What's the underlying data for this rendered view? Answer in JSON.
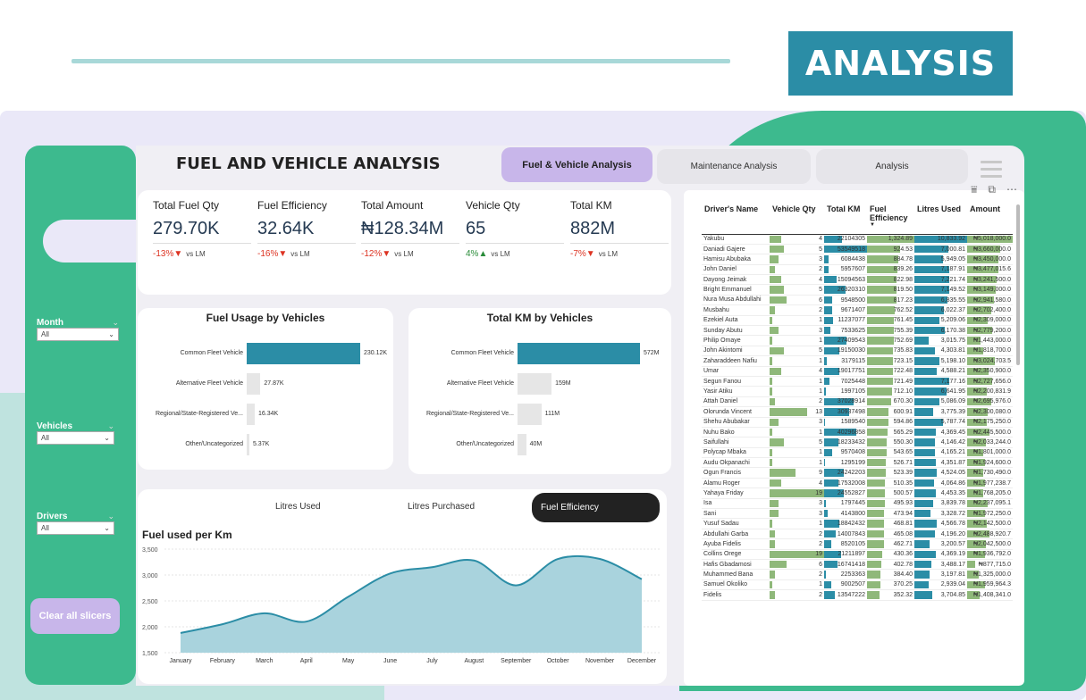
{
  "header": {
    "badge": "ANALYSIS"
  },
  "dashboard": {
    "title": "FUEL AND VEHICLE ANALYSIS",
    "tabs": [
      {
        "label": "Fuel & Vehicle Analysis",
        "active": true
      },
      {
        "label": "Maintenance Analysis",
        "active": false
      },
      {
        "label": "Analysis",
        "active": false
      }
    ]
  },
  "sidebar": {
    "slicers": [
      {
        "label": "Month",
        "value": "All"
      },
      {
        "label": "Vehicles",
        "value": "All"
      },
      {
        "label": "Drivers",
        "value": "All"
      }
    ],
    "clear_button": "Clear all slicers"
  },
  "kpis": [
    {
      "label": "Total Fuel Qty",
      "value": "279.70K",
      "change": "-13%",
      "direction": "down",
      "vs": "vs LM"
    },
    {
      "label": "Fuel Efficiency",
      "value": "32.64K",
      "change": "-16%",
      "direction": "down",
      "vs": "vs LM"
    },
    {
      "label": "Total Amount",
      "value": "₦128.34M",
      "change": "-12%",
      "direction": "down",
      "vs": "vs LM"
    },
    {
      "label": "Vehicle Qty",
      "value": "65",
      "change": "4%",
      "direction": "up",
      "vs": "vs LM"
    },
    {
      "label": "Total KM",
      "value": "882M",
      "change": "-7%",
      "direction": "down",
      "vs": "vs LM"
    }
  ],
  "chart_data": [
    {
      "type": "bar",
      "title": "Fuel Usage by Vehicles",
      "orientation": "horizontal",
      "categories": [
        "Common Fleet Vehicle",
        "Alternative Fleet Vehicle",
        "Regional/State-Registered Ve...",
        "Other/Uncategorized"
      ],
      "values": [
        230120,
        27870,
        16340,
        5370
      ],
      "value_labels": [
        "230.12K",
        "27.87K",
        "16.34K",
        "5.37K"
      ],
      "colors": [
        "#2b8da6",
        "#e6e6e6",
        "#e6e6e6",
        "#e6e6e6"
      ]
    },
    {
      "type": "bar",
      "title": "Total KM by Vehicles",
      "orientation": "horizontal",
      "categories": [
        "Common Fleet Vehicle",
        "Alternative Fleet Vehicle",
        "Regional/State-Registered Ve...",
        "Other/Uncategorized"
      ],
      "values": [
        572,
        159,
        111,
        40
      ],
      "value_labels": [
        "572M",
        "159M",
        "111M",
        "40M"
      ],
      "colors": [
        "#2b8da6",
        "#e6e6e6",
        "#e6e6e6",
        "#e6e6e6"
      ]
    },
    {
      "type": "area",
      "title": "Fuel used per Km",
      "categories": [
        "January",
        "February",
        "March",
        "April",
        "May",
        "June",
        "July",
        "August",
        "September",
        "October",
        "November",
        "December"
      ],
      "values": [
        1880,
        2050,
        2260,
        2100,
        2580,
        3030,
        3150,
        3280,
        2800,
        3310,
        3310,
        2920
      ],
      "ylim": [
        1500,
        3500
      ],
      "yticks": [
        "3,500",
        "3,000",
        "2,500",
        "2,000",
        "1,500"
      ],
      "ytick_values": [
        3500,
        3000,
        2500,
        2000,
        1500
      ],
      "colors": {
        "fill": "#a9d3dd",
        "line": "#2b8da6"
      }
    }
  ],
  "line_segments": [
    "Litres Used",
    "Litres Purchased",
    "Fuel Efficiency"
  ],
  "table": {
    "columns": [
      "Driver's Name",
      "Vehicle Qty",
      "Total KM",
      "Fuel Efficiency",
      "Litres Used",
      "Amount"
    ],
    "rows": [
      [
        "Yakubu",
        "4",
        "22104305",
        "1,324.89",
        "10,833.92",
        "₦5,018,000.0"
      ],
      [
        "Daniadi Gajere",
        "5",
        "53549518",
        "924.53",
        "7,000.81",
        "₦3,660,000.0"
      ],
      [
        "Hamisu Abubaka",
        "3",
        "6084438",
        "884.78",
        "5,949.05",
        "₦3,450,000.0"
      ],
      [
        "John Daniel",
        "2",
        "5957607",
        "839.26",
        "7,187.91",
        "₦3,477,015.6"
      ],
      [
        "Dayong Jeimak",
        "4",
        "15094563",
        "822.98",
        "7,221.74",
        "₦3,241,500.0"
      ],
      [
        "Bright Emmanuel",
        "5",
        "26320310",
        "819.50",
        "7,149.52",
        "₦3,149,000.0"
      ],
      [
        "Nura Musa Abdullahi",
        "6",
        "9548500",
        "817.23",
        "6,835.55",
        "₦2,941,580.0"
      ],
      [
        "Musbahu",
        "2",
        "9671407",
        "762.52",
        "6,022.37",
        "₦2,702,400.0"
      ],
      [
        "Ezekiel Auta",
        "1",
        "11237077",
        "761.45",
        "5,209.06",
        "₦2,309,000.0"
      ],
      [
        "Sunday Abutu",
        "3",
        "7533625",
        "755.39",
        "6,170.38",
        "₦2,779,200.0"
      ],
      [
        "Philip Omaye",
        "1",
        "27409543",
        "752.69",
        "3,015.75",
        "₦1,443,000.0"
      ],
      [
        "John Akintomi",
        "5",
        "19150030",
        "735.83",
        "4,303.81",
        "₦1,818,700.0"
      ],
      [
        "Zaharaddeen Nafiu",
        "1",
        "3179115",
        "723.15",
        "5,198.10",
        "₦3,024,703.5"
      ],
      [
        "Umar",
        "4",
        "19017751",
        "722.48",
        "4,588.21",
        "₦2,350,900.0"
      ],
      [
        "Segun Fanou",
        "1",
        "7025448",
        "721.49",
        "7,177.16",
        "₦2,727,656.0"
      ],
      [
        "Yasir Atiku",
        "1",
        "1997105",
        "712.10",
        "6,641.95",
        "₦2,200,831.9"
      ],
      [
        "Attah Daniel",
        "2",
        "37028914",
        "670.30",
        "5,086.09",
        "₦2,695,976.0"
      ],
      [
        "Olorunda Vincent",
        "13",
        "30937498",
        "600.91",
        "3,775.39",
        "₦2,300,080.0"
      ],
      [
        "Shehu Abubakar",
        "3",
        "1589540",
        "594.86",
        "5,787.74",
        "₦2,175,250.0"
      ],
      [
        "Nuhu Bako",
        "1",
        "40296858",
        "565.29",
        "4,369.45",
        "₦2,445,500.0"
      ],
      [
        "Saifullahi",
        "5",
        "18233432",
        "550.30",
        "4,146.42",
        "₦2,033,244.0"
      ],
      [
        "Polycap Mbaka",
        "1",
        "9570408",
        "543.65",
        "4,165.21",
        "₦1,801,000.0"
      ],
      [
        "Audu Okpanachi",
        "1",
        "1295199",
        "526.71",
        "4,351.87",
        "₦1,924,600.0"
      ],
      [
        "Ogun Francis",
        "9",
        "24242203",
        "523.39",
        "4,524.05",
        "₦1,730,490.0"
      ],
      [
        "Alamu Roger",
        "4",
        "17532008",
        "510.35",
        "4,064.86",
        "₦1,977,238.7"
      ],
      [
        "Yahaya Friday",
        "19",
        "24552827",
        "500.57",
        "4,453.35",
        "₦1,768,205.0"
      ],
      [
        "Isa",
        "3",
        "1797445",
        "495.93",
        "3,839.78",
        "₦2,237,095.1"
      ],
      [
        "Sani",
        "3",
        "4143800",
        "473.94",
        "3,328.72",
        "₦1,972,250.0"
      ],
      [
        "Yusuf Sadau",
        "1",
        "18842432",
        "468.81",
        "4,566.78",
        "₦2,142,500.0"
      ],
      [
        "Abdullahi Garba",
        "2",
        "14007843",
        "465.08",
        "4,196.20",
        "₦2,488,920.7"
      ],
      [
        "Ayuba Fidelis",
        "2",
        "8520105",
        "462.71",
        "3,200.57",
        "₦2,042,500.0"
      ],
      [
        "Collins Orege",
        "19",
        "21211897",
        "430.36",
        "4,369.19",
        "₦1,936,792.0"
      ],
      [
        "Hafis Gbadamosi",
        "6",
        "16741418",
        "402.78",
        "3,488.17",
        "₦877,715.0"
      ],
      [
        "Muhammed Bana",
        "2",
        "2253363",
        "384.40",
        "3,197.81",
        "₦1,325,000.0"
      ],
      [
        "Samuel Okoliko",
        "1",
        "9002507",
        "370.25",
        "2,939.04",
        "₦1,959,964.3"
      ],
      [
        "Fidelis",
        "2",
        "13547222",
        "352.32",
        "3,704.85",
        "₦1,408,341.0"
      ]
    ]
  },
  "table_icons": [
    "filter-icon",
    "expand-icon",
    "more-icon"
  ]
}
